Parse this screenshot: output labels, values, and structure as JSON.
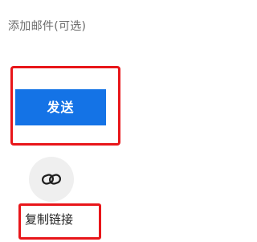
{
  "email": {
    "label": "添加邮件(可选)"
  },
  "send_button": {
    "label": "发送",
    "color": "#1473e6"
  },
  "copy_link": {
    "icon": "link-icon",
    "label": "复制链接"
  },
  "highlight_color": "#e8161a"
}
